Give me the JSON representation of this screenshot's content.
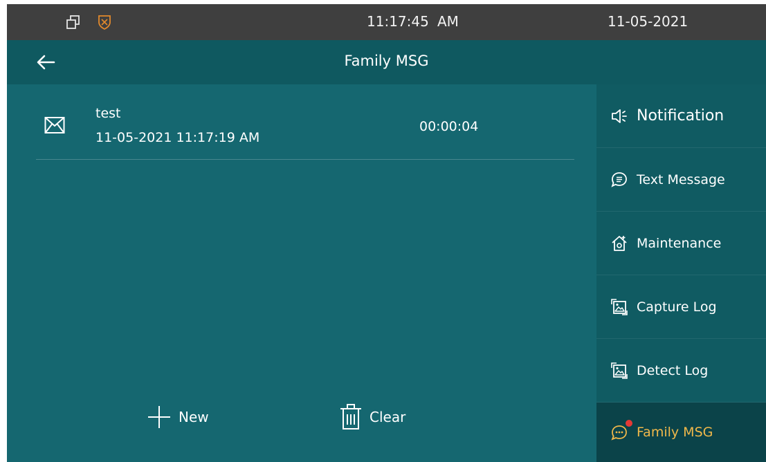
{
  "status_bar": {
    "icons": [
      "window-restore-icon",
      "shield-icon"
    ],
    "time": "11:17:45",
    "ampm": "AM",
    "date": "11-05-2021"
  },
  "header": {
    "back_icon": "arrow-left-icon",
    "title": "Family MSG"
  },
  "messages": [
    {
      "icon": "envelope-icon",
      "title": "test",
      "datetime": "11-05-2021 11:17:19 AM",
      "duration": "00:00:04"
    }
  ],
  "actions": {
    "new_label": "New",
    "new_icon": "plus-icon",
    "clear_label": "Clear",
    "clear_icon": "trash-icon"
  },
  "sidebar": {
    "items": [
      {
        "label": "Notification",
        "icon": "speaker-icon"
      },
      {
        "label": "Text Message",
        "icon": "chat-list-icon"
      },
      {
        "label": "Maintenance",
        "icon": "house-gear-icon"
      },
      {
        "label": "Capture Log",
        "icon": "image-log-icon"
      },
      {
        "label": "Detect Log",
        "icon": "image-log-icon"
      },
      {
        "label": "Family MSG",
        "icon": "chat-dots-icon",
        "active": true,
        "badge": true
      }
    ]
  },
  "colors": {
    "status_bar_bg": "#3f3f3f",
    "header_bg": "#0f5960",
    "content_bg": "#156770",
    "sidebar_bg": "#105b62",
    "active_item_bg": "#0b4349",
    "active_text": "#f0b84a",
    "shield_orange": "#e38a2c",
    "badge_red": "#e53935"
  }
}
